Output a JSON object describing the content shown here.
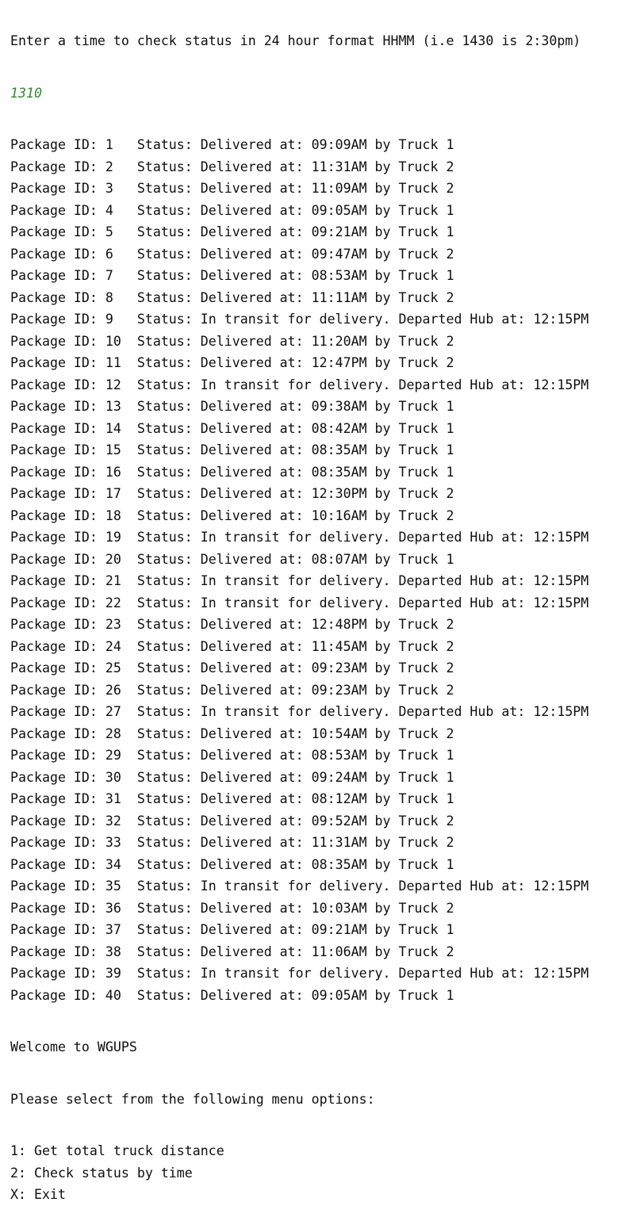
{
  "console": {
    "prompt": "Enter a time to check status in 24 hour format HHMM (i.e 1430 is 2:30pm)",
    "user_input": "1310",
    "input_color": "#2e8b2e",
    "text_color": "#0f0f0f",
    "packages": [
      "Package ID: 1   Status: Delivered at: 09:09AM by Truck 1",
      "Package ID: 2   Status: Delivered at: 11:31AM by Truck 2",
      "Package ID: 3   Status: Delivered at: 11:09AM by Truck 2",
      "Package ID: 4   Status: Delivered at: 09:05AM by Truck 1",
      "Package ID: 5   Status: Delivered at: 09:21AM by Truck 1",
      "Package ID: 6   Status: Delivered at: 09:47AM by Truck 2",
      "Package ID: 7   Status: Delivered at: 08:53AM by Truck 1",
      "Package ID: 8   Status: Delivered at: 11:11AM by Truck 2",
      "Package ID: 9   Status: In transit for delivery. Departed Hub at: 12:15PM",
      "Package ID: 10  Status: Delivered at: 11:20AM by Truck 2",
      "Package ID: 11  Status: Delivered at: 12:47PM by Truck 2",
      "Package ID: 12  Status: In transit for delivery. Departed Hub at: 12:15PM",
      "Package ID: 13  Status: Delivered at: 09:38AM by Truck 1",
      "Package ID: 14  Status: Delivered at: 08:42AM by Truck 1",
      "Package ID: 15  Status: Delivered at: 08:35AM by Truck 1",
      "Package ID: 16  Status: Delivered at: 08:35AM by Truck 1",
      "Package ID: 17  Status: Delivered at: 12:30PM by Truck 2",
      "Package ID: 18  Status: Delivered at: 10:16AM by Truck 2",
      "Package ID: 19  Status: In transit for delivery. Departed Hub at: 12:15PM",
      "Package ID: 20  Status: Delivered at: 08:07AM by Truck 1",
      "Package ID: 21  Status: In transit for delivery. Departed Hub at: 12:15PM",
      "Package ID: 22  Status: In transit for delivery. Departed Hub at: 12:15PM",
      "Package ID: 23  Status: Delivered at: 12:48PM by Truck 2",
      "Package ID: 24  Status: Delivered at: 11:45AM by Truck 2",
      "Package ID: 25  Status: Delivered at: 09:23AM by Truck 2",
      "Package ID: 26  Status: Delivered at: 09:23AM by Truck 2",
      "Package ID: 27  Status: In transit for delivery. Departed Hub at: 12:15PM",
      "Package ID: 28  Status: Delivered at: 10:54AM by Truck 2",
      "Package ID: 29  Status: Delivered at: 08:53AM by Truck 1",
      "Package ID: 30  Status: Delivered at: 09:24AM by Truck 1",
      "Package ID: 31  Status: Delivered at: 08:12AM by Truck 1",
      "Package ID: 32  Status: Delivered at: 09:52AM by Truck 2",
      "Package ID: 33  Status: Delivered at: 11:31AM by Truck 2",
      "Package ID: 34  Status: Delivered at: 08:35AM by Truck 1",
      "Package ID: 35  Status: In transit for delivery. Departed Hub at: 12:15PM",
      "Package ID: 36  Status: Delivered at: 10:03AM by Truck 2",
      "Package ID: 37  Status: Delivered at: 09:21AM by Truck 1",
      "Package ID: 38  Status: Delivered at: 11:06AM by Truck 2",
      "Package ID: 39  Status: In transit for delivery. Departed Hub at: 12:15PM",
      "Package ID: 40  Status: Delivered at: 09:05AM by Truck 1"
    ],
    "welcome": "Welcome to WGUPS",
    "menu_prompt": "Please select from the following menu options:",
    "menu_options": [
      "1: Get total truck distance",
      "2: Check status by time",
      "X: Exit"
    ]
  }
}
